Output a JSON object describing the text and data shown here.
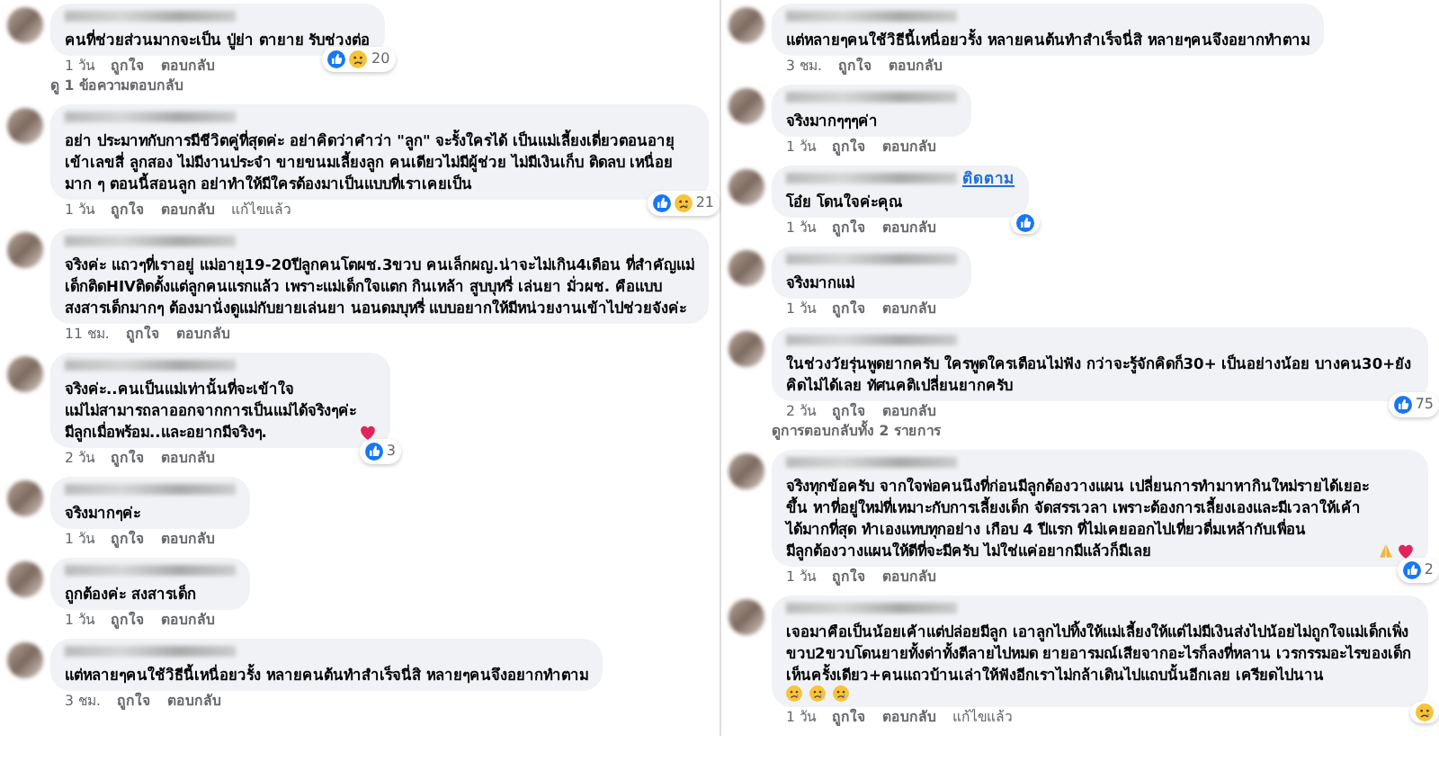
{
  "columns": [
    {
      "comments": [
        {
          "text": "คนที่ช่วยส่วนมากจะเป็น ปู่ย่า ตายาย รับช่วงต่อ",
          "time": "1 วัน",
          "actions": [
            "ถูกใจ",
            "ตอบกลับ"
          ],
          "reactions": {
            "icons": [
              {
                "kind": "like"
              },
              {
                "kind": "sad"
              }
            ],
            "count": "20"
          },
          "replies": "ดู 1 ข้อความตอบกลับ"
        },
        {
          "text": "อย่า ประมาทกับการมีชีวิตคู่ที่สุดค่ะ อย่าคิดว่าคำว่า \"ลูก\" จะรั้งใครได้ เป็นแม่เลี้ยงเดี่ยวตอนอายุเข้าเลขสี่ ลูกสอง ไม่มีงานประจำ ขายขนมเลี้ยงลูก คนเดียวไม่มีผู้ช่วย ไม่มีเงินเก็บ ติดลบ เหนื่อยมาก ๆ ตอนนี้สอนลูก อย่าทำให้มีใครต้องมาเป็นแบบที่เราเคยเป็น",
          "time": "1 วัน",
          "actions": [
            "ถูกใจ",
            "ตอบกลับ"
          ],
          "edited": "แก้ไขแล้ว",
          "reactions": {
            "icons": [
              {
                "kind": "like"
              },
              {
                "kind": "sad"
              }
            ],
            "count": "21"
          }
        },
        {
          "text": "จริงค่ะ แถวๆที่เราอยู่ แม่อายุ19-20ปีลูกคนโตผช.3ขวบ คนเล็กผญ.น่าจะไม่เกิน4เดือน ที่สำคัญแม่เด็กติดHIVติดตั้งแต่ลูกคนแรกแล้ว เพราะแม่เด็กใจแตก กินเหล้า สูบบุหรี่ เล่นยา มั่วผช. คือแบบสงสารเด็กมากๆ ต้องมานั่งดูแม่กับยายเล่นยา นอนดมบุหรี่ แบบอยากให้มีหน่วยงานเข้าไปช่วยจังค่ะ",
          "time": "11 ชม.",
          "actions": [
            "ถูกใจ",
            "ตอบกลับ"
          ]
        },
        {
          "text": "จริงค่ะ..คนเป็นแม่เท่านั้นที่จะเข้าใจ\nแม่ไม่สามารถลาออกจากการเป็นแม่ได้จริงๆค่ะ\nมีลูกเมื่อพร้อม..และอยากมีจริงๆ.",
          "emojis": [
            {
              "kind": "heart"
            }
          ],
          "time": "2 วัน",
          "actions": [
            "ถูกใจ",
            "ตอบกลับ"
          ],
          "reactions": {
            "icons": [
              {
                "kind": "like"
              }
            ],
            "count": "3"
          }
        },
        {
          "text": "จริงมากๆค่ะ",
          "time": "1 วัน",
          "actions": [
            "ถูกใจ",
            "ตอบกลับ"
          ]
        },
        {
          "text": "ถูกต้องค่ะ สงสารเด็ก",
          "time": "1 วัน",
          "actions": [
            "ถูกใจ",
            "ตอบกลับ"
          ]
        },
        {
          "text": "แต่หลายๆคนใช้วิธีนี้เหนื่อยวรั้ง หลายคนต้นทำสำเร็จนี่สิ หลายๆคนจึงอยากทำตาม",
          "time": "3 ชม.",
          "actions": [
            "ถูกใจ",
            "ตอบกลับ"
          ]
        }
      ]
    },
    {
      "comments": [
        {
          "text": "แต่หลายๆคนใช้วิธีนี้เหนื่อยวรั้ง หลายคนต้นทำสำเร็จนี่สิ หลายๆคนจึงอยากทำตาม",
          "time": "3 ชม.",
          "actions": [
            "ถูกใจ",
            "ตอบกลับ"
          ]
        },
        {
          "text": "จริงมากๆๆๆค่า",
          "time": "1 วัน",
          "actions": [
            "ถูกใจ",
            "ตอบกลับ"
          ]
        },
        {
          "text": "โอ๋ย โดนใจค่ะคุณ",
          "follow": "ติดตาม",
          "time": "1 วัน",
          "actions": [
            "ถูกใจ",
            "ตอบกลับ"
          ],
          "reactions": {
            "icons": [
              {
                "kind": "like"
              }
            ]
          }
        },
        {
          "text": "จริงมากแม่",
          "time": "1 วัน",
          "actions": [
            "ถูกใจ",
            "ตอบกลับ"
          ]
        },
        {
          "text": "ในช่วงวัยรุ่นพูดยากครับ ใครพูดใครเตือนไม่ฟัง กว่าจะรู้จักคิดก็30+ เป็นอย่างน้อย บางคน30+ยังคิดไม่ได้เลย ทัศนคติเปลี่ยนยากครับ",
          "time": "2 วัน",
          "actions": [
            "ถูกใจ",
            "ตอบกลับ"
          ],
          "reactions": {
            "icons": [
              {
                "kind": "like"
              }
            ],
            "count": "75"
          },
          "replies": "ดูการตอบกลับทั้ง 2 รายการ"
        },
        {
          "text": "จริงทุกข้อครับ จากใจพ่อคนนึงที่ก่อนมีลูกต้องวางแผน เปลี่ยนการทำมาหากินใหม่รายได้เยอะขึ้น หาที่อยู่ใหม่ที่เหมาะกับการเลี้ยงเด็ก จัดสรรเวลา เพราะต้องการเลี้ยงเองและมีเวลาให้เค้าได้มากที่สุด ทำเองแทบทุกอย่าง เกือบ 4 ปีแรก ที่ไม่เคยออกไปเที่ยวดื่มเหล้ากับเพื่อน\nมีลูกต้องวางแผนให้ดีที่จะมีครับ ไม่ใช่แค่อยากมีแล้วก็มีเลย",
          "emojis": [
            {
              "kind": "pray"
            },
            {
              "kind": "heart"
            }
          ],
          "time": "1 วัน",
          "actions": [
            "ถูกใจ",
            "ตอบกลับ"
          ],
          "reactions": {
            "icons": [
              {
                "kind": "like"
              }
            ],
            "count": "2"
          }
        },
        {
          "text": "เจอมาคือเป็นน้อยเค้าแต่ปล่อยมีลูก เอาลูกไปทิ้งให้แม่เลี้ยงให้แต่ไม่มีเงินส่งไปน้อยไม่ถูกใจแม่เด็กเพิ่งขวบ2ขวบโดนยายทั้งด่าทั้งตีลายไปหมด ยายอารมณ์เสียจากอะไรก็ลงที่หลาน เวรกรรมอะไรของเด็ก เห็นครั้งเดียว+คนแถวบ้านเล่าให้ฟังอีกเราไม่กล้าเดินไปแถบนั้นอีกเลย เครียดไปนาน",
          "emojis_line": [
            {
              "kind": "sad"
            },
            {
              "kind": "sad"
            },
            {
              "kind": "sad"
            }
          ],
          "time": "1 วัน",
          "actions": [
            "ถูกใจ",
            "ตอบกลับ"
          ],
          "edited": "แก้ไขแล้ว",
          "reactions": {
            "icons": [
              {
                "kind": "sad"
              }
            ]
          }
        }
      ]
    }
  ]
}
